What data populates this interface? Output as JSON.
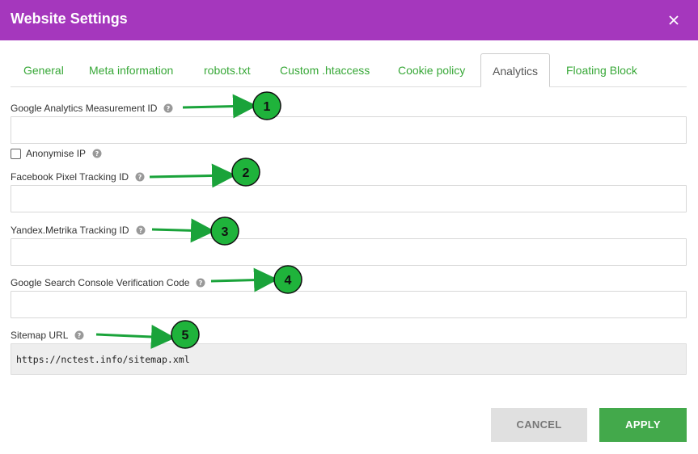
{
  "window": {
    "title": "Website Settings"
  },
  "tabs": [
    {
      "label": "General"
    },
    {
      "label": "Meta information"
    },
    {
      "label": "robots.txt"
    },
    {
      "label": "Custom .htaccess"
    },
    {
      "label": "Cookie policy"
    },
    {
      "label": "Analytics",
      "active": true
    },
    {
      "label": "Floating Block"
    }
  ],
  "form": {
    "ga_label": "Google Analytics Measurement ID",
    "ga_value": "",
    "anonymise_label": "Anonymise IP",
    "anonymise_checked": false,
    "fb_label": "Facebook Pixel Tracking ID",
    "fb_value": "",
    "yandex_label": "Yandex.Metrika Tracking ID",
    "yandex_value": "",
    "gsc_label": "Google Search Console Verification Code",
    "gsc_value": "",
    "sitemap_label": "Sitemap URL",
    "sitemap_value": "https://nctest.info/sitemap.xml"
  },
  "annotations": [
    "1",
    "2",
    "3",
    "4",
    "5"
  ],
  "buttons": {
    "cancel": "CANCEL",
    "apply": "APPLY"
  },
  "colors": {
    "titlebar": "#a537bd",
    "tab_text": "#38a838",
    "apply": "#43a94b",
    "annotation": "#1aa33a"
  }
}
